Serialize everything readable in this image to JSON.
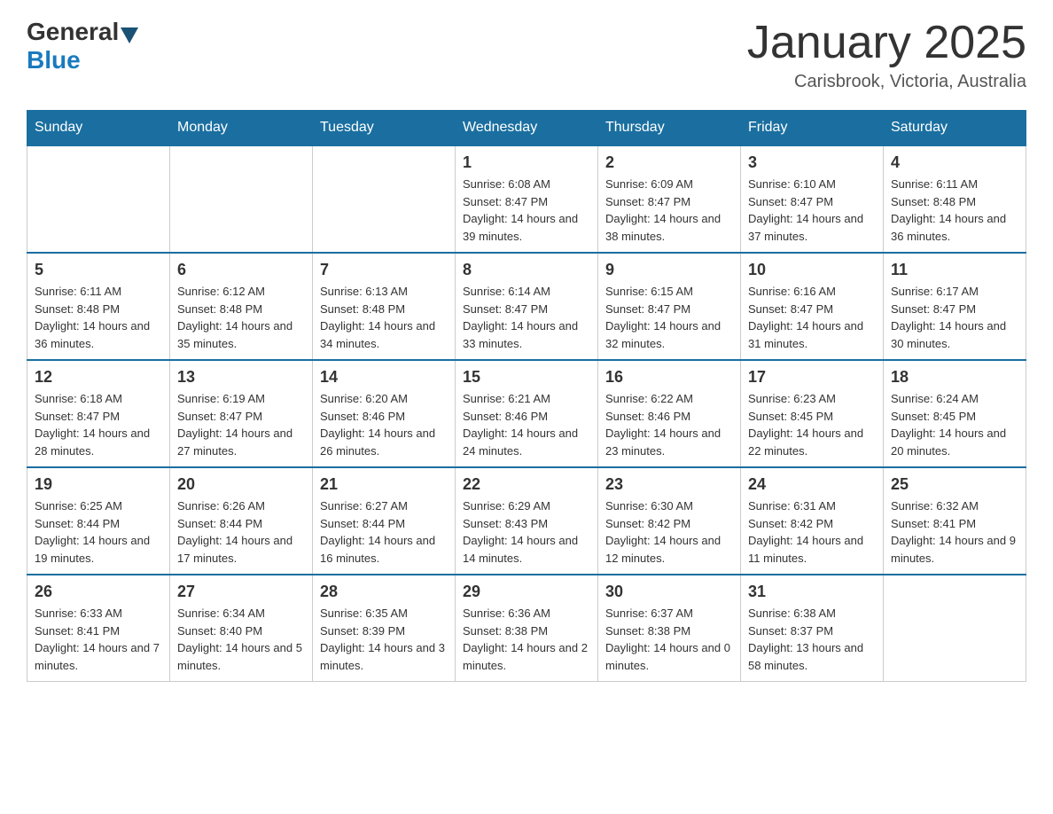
{
  "header": {
    "logo_text_general": "General",
    "logo_text_blue": "Blue",
    "title": "January 2025",
    "subtitle": "Carisbrook, Victoria, Australia"
  },
  "days_of_week": [
    "Sunday",
    "Monday",
    "Tuesday",
    "Wednesday",
    "Thursday",
    "Friday",
    "Saturday"
  ],
  "weeks": [
    {
      "days": [
        {
          "number": "",
          "info": ""
        },
        {
          "number": "",
          "info": ""
        },
        {
          "number": "",
          "info": ""
        },
        {
          "number": "1",
          "info": "Sunrise: 6:08 AM\nSunset: 8:47 PM\nDaylight: 14 hours and 39 minutes."
        },
        {
          "number": "2",
          "info": "Sunrise: 6:09 AM\nSunset: 8:47 PM\nDaylight: 14 hours and 38 minutes."
        },
        {
          "number": "3",
          "info": "Sunrise: 6:10 AM\nSunset: 8:47 PM\nDaylight: 14 hours and 37 minutes."
        },
        {
          "number": "4",
          "info": "Sunrise: 6:11 AM\nSunset: 8:48 PM\nDaylight: 14 hours and 36 minutes."
        }
      ]
    },
    {
      "days": [
        {
          "number": "5",
          "info": "Sunrise: 6:11 AM\nSunset: 8:48 PM\nDaylight: 14 hours and 36 minutes."
        },
        {
          "number": "6",
          "info": "Sunrise: 6:12 AM\nSunset: 8:48 PM\nDaylight: 14 hours and 35 minutes."
        },
        {
          "number": "7",
          "info": "Sunrise: 6:13 AM\nSunset: 8:48 PM\nDaylight: 14 hours and 34 minutes."
        },
        {
          "number": "8",
          "info": "Sunrise: 6:14 AM\nSunset: 8:47 PM\nDaylight: 14 hours and 33 minutes."
        },
        {
          "number": "9",
          "info": "Sunrise: 6:15 AM\nSunset: 8:47 PM\nDaylight: 14 hours and 32 minutes."
        },
        {
          "number": "10",
          "info": "Sunrise: 6:16 AM\nSunset: 8:47 PM\nDaylight: 14 hours and 31 minutes."
        },
        {
          "number": "11",
          "info": "Sunrise: 6:17 AM\nSunset: 8:47 PM\nDaylight: 14 hours and 30 minutes."
        }
      ]
    },
    {
      "days": [
        {
          "number": "12",
          "info": "Sunrise: 6:18 AM\nSunset: 8:47 PM\nDaylight: 14 hours and 28 minutes."
        },
        {
          "number": "13",
          "info": "Sunrise: 6:19 AM\nSunset: 8:47 PM\nDaylight: 14 hours and 27 minutes."
        },
        {
          "number": "14",
          "info": "Sunrise: 6:20 AM\nSunset: 8:46 PM\nDaylight: 14 hours and 26 minutes."
        },
        {
          "number": "15",
          "info": "Sunrise: 6:21 AM\nSunset: 8:46 PM\nDaylight: 14 hours and 24 minutes."
        },
        {
          "number": "16",
          "info": "Sunrise: 6:22 AM\nSunset: 8:46 PM\nDaylight: 14 hours and 23 minutes."
        },
        {
          "number": "17",
          "info": "Sunrise: 6:23 AM\nSunset: 8:45 PM\nDaylight: 14 hours and 22 minutes."
        },
        {
          "number": "18",
          "info": "Sunrise: 6:24 AM\nSunset: 8:45 PM\nDaylight: 14 hours and 20 minutes."
        }
      ]
    },
    {
      "days": [
        {
          "number": "19",
          "info": "Sunrise: 6:25 AM\nSunset: 8:44 PM\nDaylight: 14 hours and 19 minutes."
        },
        {
          "number": "20",
          "info": "Sunrise: 6:26 AM\nSunset: 8:44 PM\nDaylight: 14 hours and 17 minutes."
        },
        {
          "number": "21",
          "info": "Sunrise: 6:27 AM\nSunset: 8:44 PM\nDaylight: 14 hours and 16 minutes."
        },
        {
          "number": "22",
          "info": "Sunrise: 6:29 AM\nSunset: 8:43 PM\nDaylight: 14 hours and 14 minutes."
        },
        {
          "number": "23",
          "info": "Sunrise: 6:30 AM\nSunset: 8:42 PM\nDaylight: 14 hours and 12 minutes."
        },
        {
          "number": "24",
          "info": "Sunrise: 6:31 AM\nSunset: 8:42 PM\nDaylight: 14 hours and 11 minutes."
        },
        {
          "number": "25",
          "info": "Sunrise: 6:32 AM\nSunset: 8:41 PM\nDaylight: 14 hours and 9 minutes."
        }
      ]
    },
    {
      "days": [
        {
          "number": "26",
          "info": "Sunrise: 6:33 AM\nSunset: 8:41 PM\nDaylight: 14 hours and 7 minutes."
        },
        {
          "number": "27",
          "info": "Sunrise: 6:34 AM\nSunset: 8:40 PM\nDaylight: 14 hours and 5 minutes."
        },
        {
          "number": "28",
          "info": "Sunrise: 6:35 AM\nSunset: 8:39 PM\nDaylight: 14 hours and 3 minutes."
        },
        {
          "number": "29",
          "info": "Sunrise: 6:36 AM\nSunset: 8:38 PM\nDaylight: 14 hours and 2 minutes."
        },
        {
          "number": "30",
          "info": "Sunrise: 6:37 AM\nSunset: 8:38 PM\nDaylight: 14 hours and 0 minutes."
        },
        {
          "number": "31",
          "info": "Sunrise: 6:38 AM\nSunset: 8:37 PM\nDaylight: 13 hours and 58 minutes."
        },
        {
          "number": "",
          "info": ""
        }
      ]
    }
  ]
}
